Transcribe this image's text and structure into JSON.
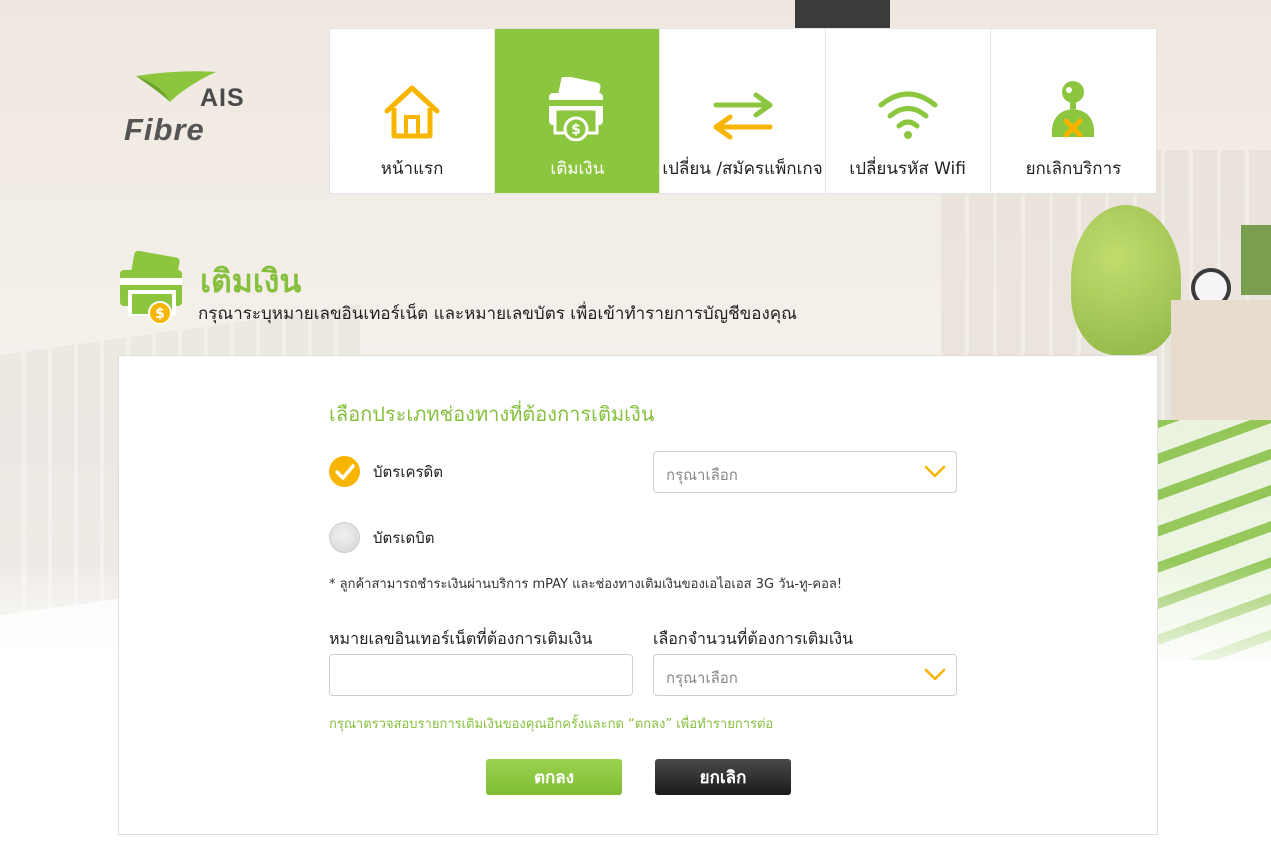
{
  "brand": {
    "name_top": "AIS",
    "name_bottom": "Fibre"
  },
  "nav": {
    "items": [
      {
        "label": "หน้าแรก",
        "icon": "home-icon",
        "active": false
      },
      {
        "label": "เติมเงิน",
        "icon": "topup-card-icon",
        "active": true
      },
      {
        "label": "เปลี่ยน /สมัครแพ็กเกจ",
        "icon": "swap-arrows-icon",
        "active": false
      },
      {
        "label": "เปลี่ยนรหัส Wifi",
        "icon": "wifi-icon",
        "active": false
      },
      {
        "label": "ยกเลิกบริการ",
        "icon": "cancel-service-icon",
        "active": false
      }
    ]
  },
  "page": {
    "title": "เติมเงิน",
    "subtitle": "กรุณาระบุหมายเลขอินเทอร์เน็ต และหมายเลขบัตร เพื่อเข้าทำรายการบัญชีของคุณ"
  },
  "form": {
    "section_title": "เลือกประเภทช่องทางที่ต้องการเติมเงิน",
    "options": [
      {
        "label": "บัตรเครดิต",
        "selected": true
      },
      {
        "label": "บัตรเดบิต",
        "selected": false
      }
    ],
    "card_select": {
      "placeholder": "กรุณาเลือก"
    },
    "note": "* ลูกค้าสามารถชำระเงินผ่านบริการ mPAY และช่องทางเติมเงินของเอไอเอส 3G วัน-ทู-คอล!",
    "internet_number": {
      "label": "หมายเลขอินเทอร์เน็ตที่ต้องการเติมเงิน",
      "value": ""
    },
    "amount": {
      "label": "เลือกจำนวนที่ต้องการเติมเงิน",
      "placeholder": "กรุณาเลือก"
    },
    "confirm_note": "กรุณาตรวจสอบรายการเติมเงินของคุณอีกครั้งและกด “ตกลง” เพื่อทำรายการต่อ",
    "ok_label": "ตกลง",
    "cancel_label": "ยกเลิก"
  },
  "colors": {
    "accent_green": "#8cc63e",
    "accent_orange": "#f7b500",
    "dark_button": "#1a1a1a"
  }
}
